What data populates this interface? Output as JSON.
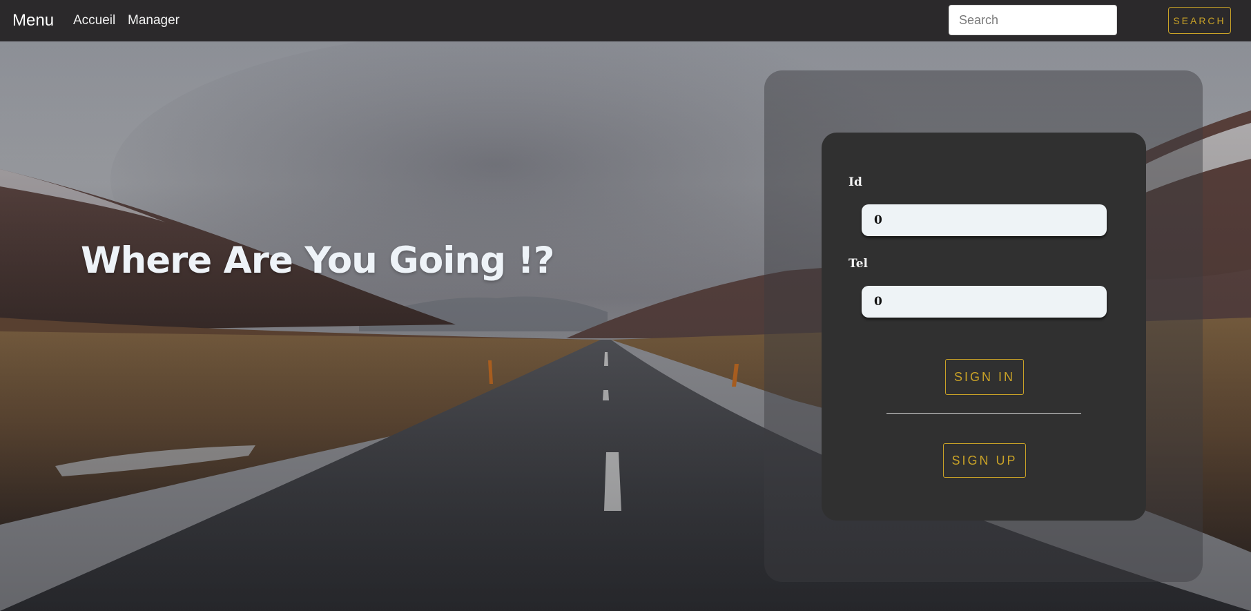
{
  "navbar": {
    "brand": "Menu",
    "links": [
      "Accueil",
      "Manager"
    ],
    "search": {
      "placeholder": "Search",
      "button_label": "SEARCH"
    }
  },
  "hero": {
    "title": "Where Are You Going !?"
  },
  "login": {
    "id_label": "Id",
    "id_value": "0",
    "tel_label": "Tel",
    "tel_value": "0",
    "signin_label": "SIGN IN",
    "signup_label": "SIGN UP"
  },
  "colors": {
    "navbar_bg": "#2b292b",
    "accent_gold": "#c9a227",
    "card_bg": "#303030",
    "input_bg": "#eef3f6",
    "hero_title": "#eef3f8"
  }
}
